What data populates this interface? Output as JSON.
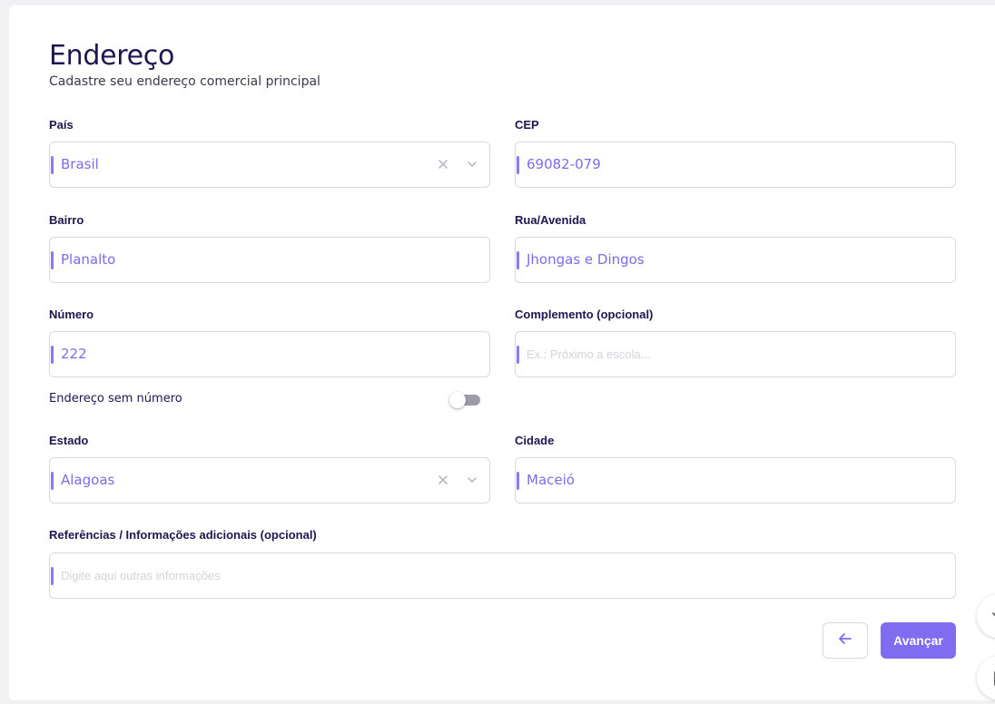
{
  "header": {
    "title": "Endereço",
    "subtitle": "Cadastre seu endereço comercial principal"
  },
  "fields": {
    "pais": {
      "label": "País",
      "value": "Brasil"
    },
    "cep": {
      "label": "CEP",
      "value": "69082-079"
    },
    "bairro": {
      "label": "Bairro",
      "value": "Planalto"
    },
    "rua": {
      "label": "Rua/Avenida",
      "value": "Jhongas e Dingos"
    },
    "numero": {
      "label": "Número",
      "value": "222"
    },
    "complemento": {
      "label": "Complemento (opcional)",
      "value": "",
      "placeholder": "Ex.: Próximo a escola..."
    },
    "estado": {
      "label": "Estado",
      "value": "Alagoas"
    },
    "cidade": {
      "label": "Cidade",
      "value": "Maceió"
    },
    "referencias": {
      "label": "Referências / Informações adicionais (opcional)",
      "value": "",
      "placeholder": "Digite aqui outras informações"
    }
  },
  "toggle": {
    "label": "Endereço sem número",
    "checked": false
  },
  "actions": {
    "next_label": "Avançar"
  },
  "colors": {
    "accent": "#7f6cf0",
    "title": "#1d1650",
    "value_text": "#7c6ce8",
    "border": "#d9d9e1"
  },
  "icons": {
    "clear": "close-icon",
    "dropdown": "chevron-down-icon",
    "back": "arrow-left-icon"
  }
}
